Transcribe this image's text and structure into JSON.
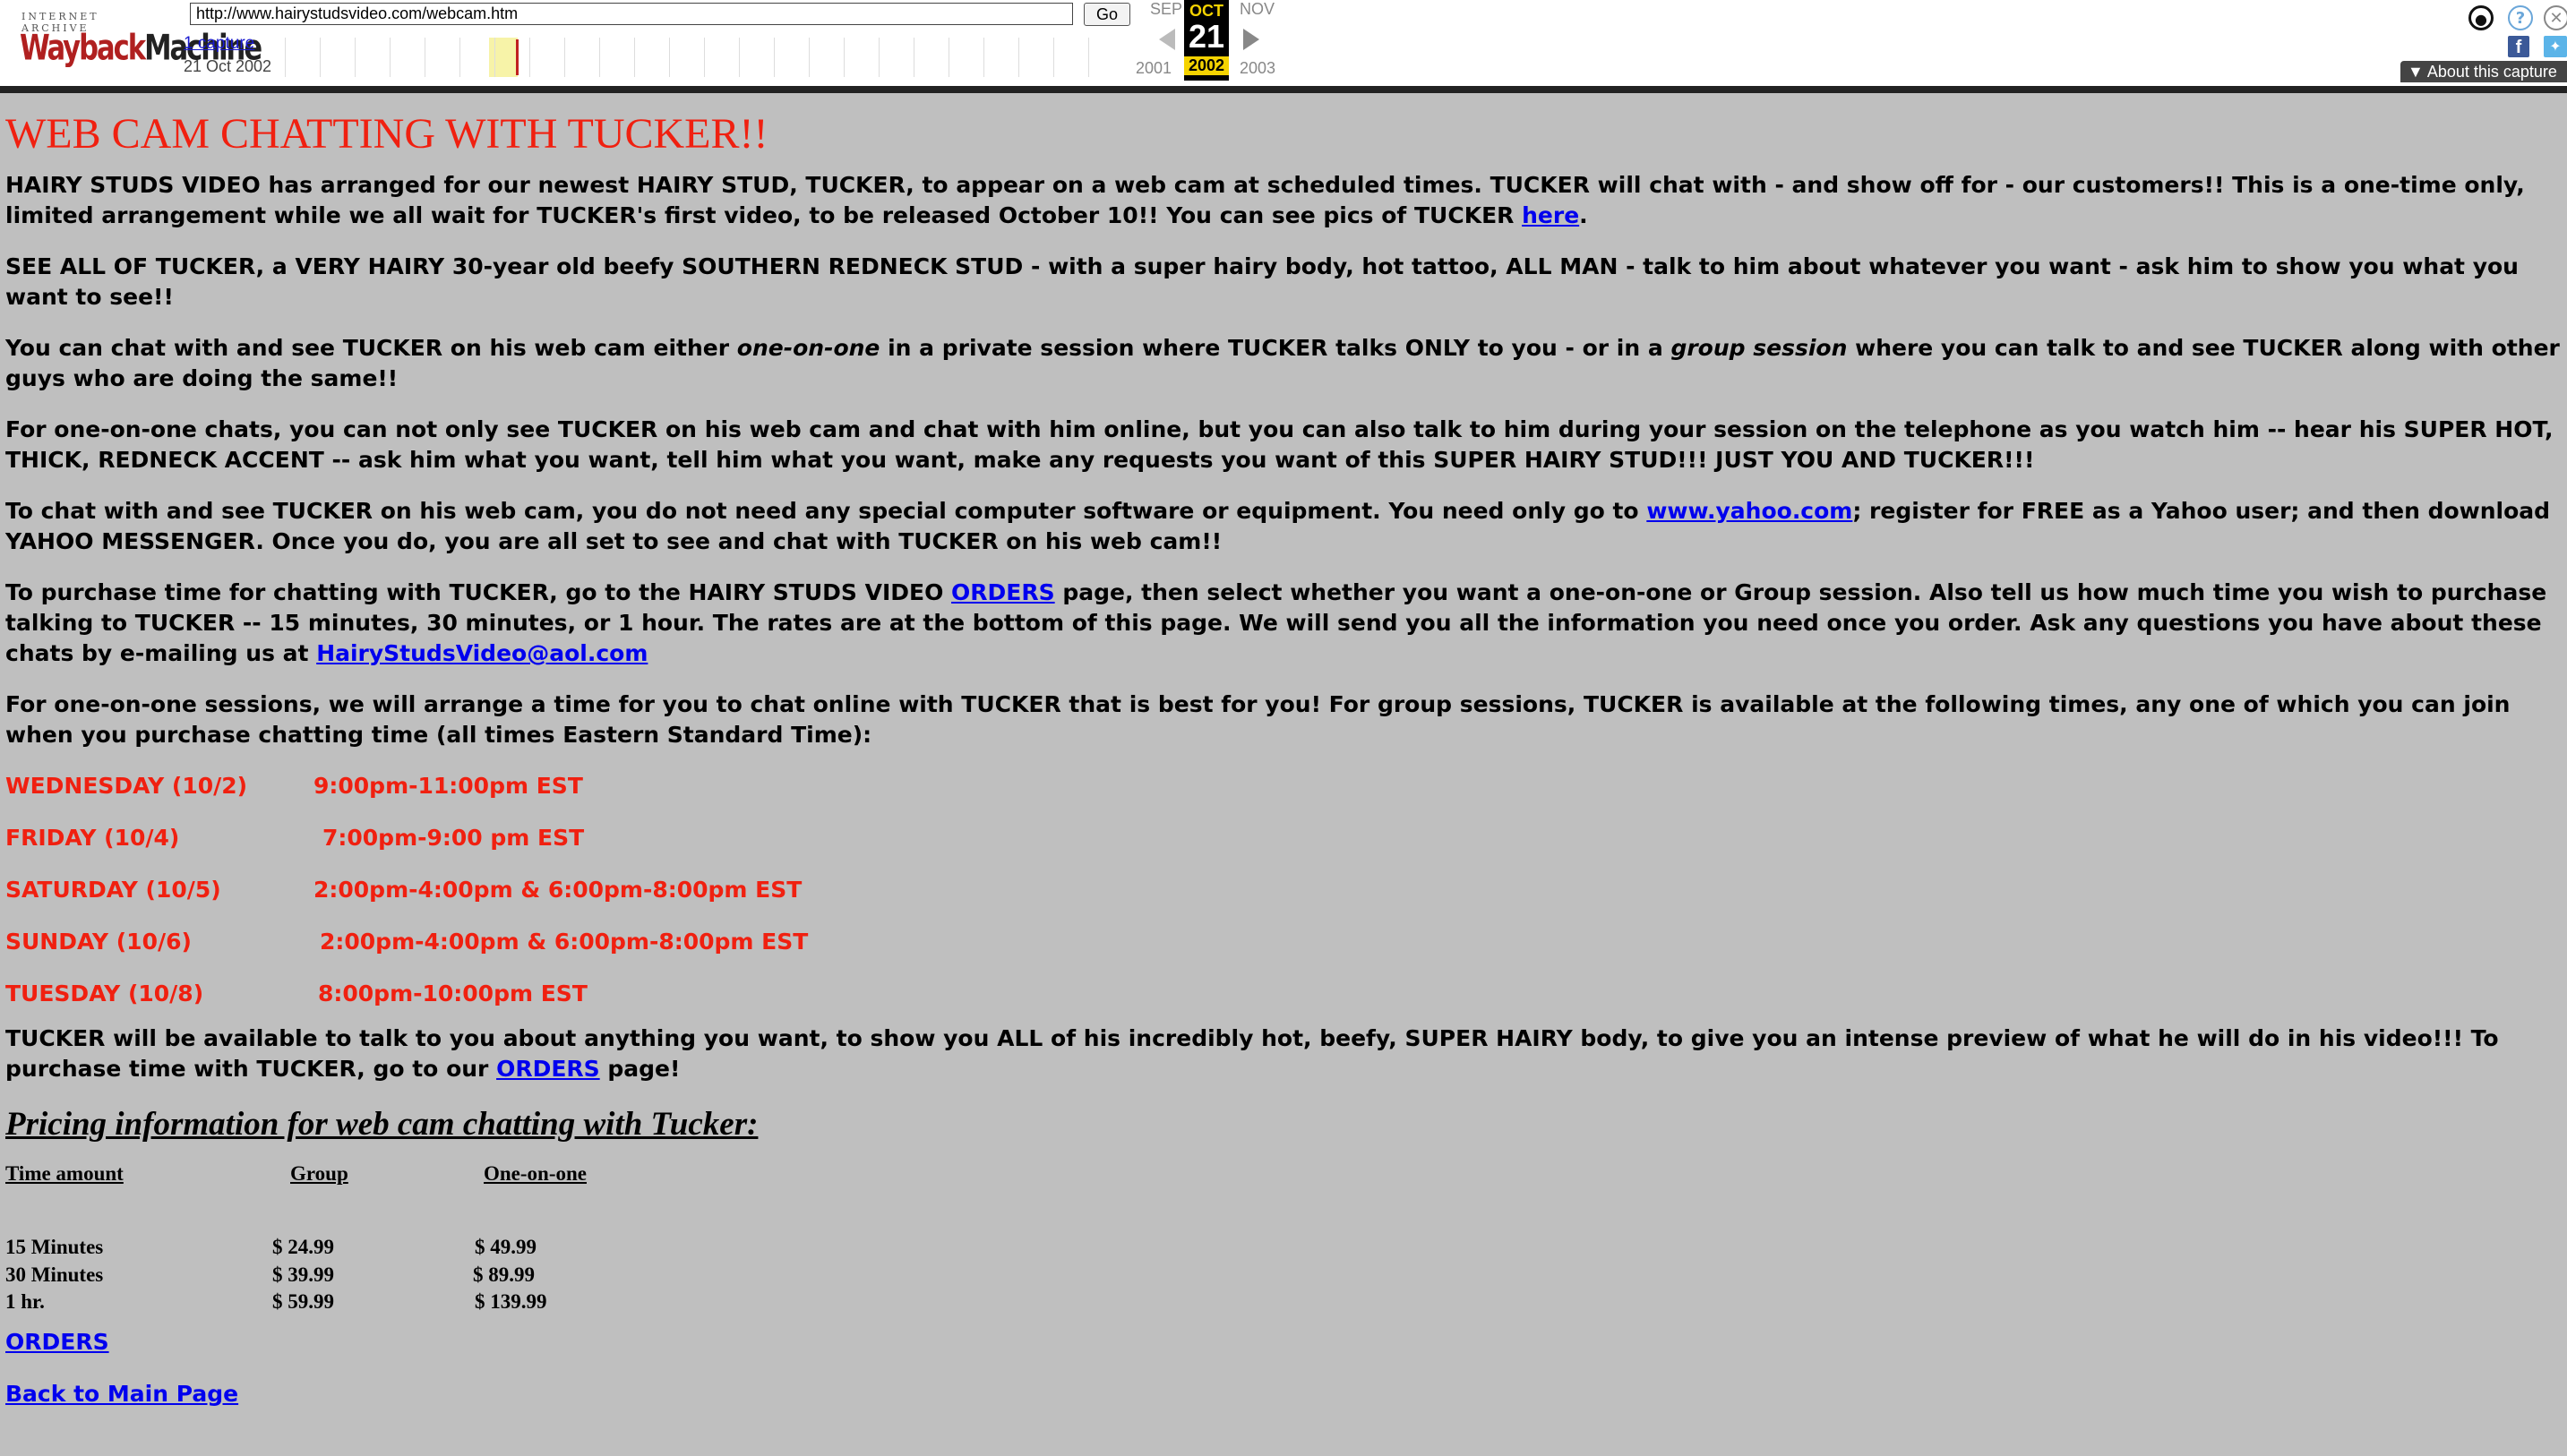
{
  "toolbar": {
    "logo_top": "INTERNET ARCHIVE",
    "logo_way": "Wayback",
    "logo_machine": "Machine",
    "url": "http://www.hairystudsvideo.com/webcam.htm",
    "go_label": "Go",
    "captures_label": "1 capture",
    "capture_date": "21 Oct 2002",
    "prev_month": "SEP",
    "cur_month": "OCT",
    "next_month": "NOV",
    "cur_day": "21",
    "prev_year": "2001",
    "cur_year": "2002",
    "next_year": "2003",
    "about_label": "About this capture"
  },
  "page": {
    "title": "WEB CAM CHATTING WITH TUCKER!!",
    "p1_a": "HAIRY STUDS VIDEO has arranged for our newest HAIRY STUD, TUCKER, to appear on a web cam at scheduled times.  TUCKER will chat with - and show off for - our customers!!   This is a one-time only, limited arrangement while we all wait for TUCKER's first video, to be released October 10!!  You can see pics of TUCKER ",
    "p1_link": "here",
    "p1_b": ".",
    "p2": "SEE ALL OF TUCKER, a VERY HAIRY 30-year old beefy SOUTHERN REDNECK STUD - with a super hairy body, hot tattoo, ALL MAN - talk to him about whatever you want - ask him to show you what you want to see!!",
    "p3_a": "You can chat with and see TUCKER on his web cam either ",
    "p3_em1": "one-on-one",
    "p3_b": " in a private session where TUCKER talks ONLY to you - or in a ",
    "p3_em2": "group session",
    "p3_c": " where you can talk to and see TUCKER along with other guys who are doing the same!!",
    "p4": "For one-on-one chats, you can not only see TUCKER on his web cam and chat with him online, but you can also talk to him during your session on the telephone as you watch him -- hear his SUPER HOT, THICK, REDNECK ACCENT -- ask him what you want, tell him what you want, make any requests you want of this SUPER HAIRY STUD!!!  JUST YOU AND TUCKER!!!",
    "p5_a": "To chat with and see TUCKER on his web cam, you do not need any special computer software or equipment.  You need only go to ",
    "p5_link": "www.yahoo.com",
    "p5_b": "; register for FREE as a Yahoo user; and then download YAHOO MESSENGER.  Once you do, you are all set to see and chat with TUCKER on his web cam!!",
    "p6_a": "To purchase time for chatting with TUCKER, go to the HAIRY STUDS VIDEO ",
    "p6_link": "ORDERS",
    "p6_b": " page, then select whether you want a one-on-one or Group session.  Also tell us how much time you wish to purchase talking to TUCKER -- 15 minutes, 30 minutes, or 1 hour.  The rates are at the bottom of this page.  We will send you all the information you need once you order.  Ask any questions you have about these chats by e-mailing us at ",
    "p6_email": "HairyStudsVideo@aol.com",
    "p7": "For one-on-one sessions, we will arrange a time for you to chat online with TUCKER that is best for you!  For group sessions, TUCKER is available at the following times, any one of which you can join when you purchase chatting time (all times Eastern Standard Time):",
    "schedule": [
      {
        "day": "WEDNESDAY (10/2)",
        "time": "9:00pm-11:00pm EST"
      },
      {
        "day": "FRIDAY (10/4)",
        "time": "7:00pm-9:00 pm EST"
      },
      {
        "day": "SATURDAY (10/5)",
        "time": "2:00pm-4:00pm & 6:00pm-8:00pm EST"
      },
      {
        "day": "SUNDAY (10/6)",
        "time": "2:00pm-4:00pm & 6:00pm-8:00pm EST"
      },
      {
        "day": "TUESDAY (10/8)",
        "time": "8:00pm-10:00pm EST"
      }
    ],
    "p8_a": "TUCKER will be available to talk to you about anything you want, to show you ALL of his incredibly hot, beefy, SUPER HAIRY body, to give you an intense preview of what he will do in his video!!!  To purchase time with TUCKER, go to our ",
    "p8_link": "ORDERS",
    "p8_b": " page!",
    "pricing_title": "Pricing information for web cam chatting with Tucker:",
    "pricing_headers": [
      "Time amount",
      "Group",
      "One-on-one"
    ],
    "pricing_rows": [
      [
        "15 Minutes",
        "$ 24.99",
        "$   49.99"
      ],
      [
        "30 Minutes",
        "$ 39.99",
        "$    89.99"
      ],
      [
        "1 hr.",
        "$  59.99",
        "$ 139.99"
      ]
    ],
    "orders_link": "ORDERS",
    "back_link": "Back to Main Page"
  }
}
